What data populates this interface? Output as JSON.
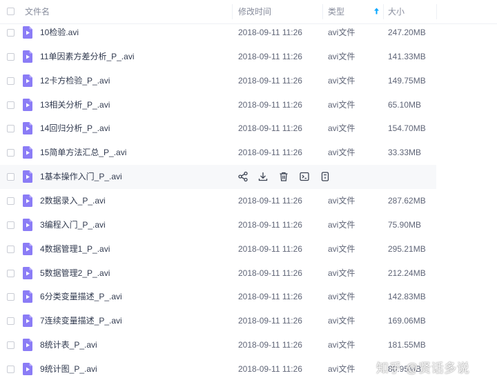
{
  "header": {
    "name_label": "文件名",
    "modified_label": "修改时间",
    "type_label": "类型",
    "size_label": "大小",
    "sort_icon": "sort-ascending-arrow-icon"
  },
  "colors": {
    "accent": "#06a7ff",
    "video_icon": "#8b7cf6",
    "hover_row": "#f7f8fa"
  },
  "files": [
    {
      "name": "10检验.avi",
      "modified": "2018-09-11 11:26",
      "type": "avi文件",
      "size": "247.20MB"
    },
    {
      "name": "11单因素方差分析_P_.avi",
      "modified": "2018-09-11 11:26",
      "type": "avi文件",
      "size": "141.33MB"
    },
    {
      "name": "12卡方检验_P_.avi",
      "modified": "2018-09-11 11:26",
      "type": "avi文件",
      "size": "149.75MB"
    },
    {
      "name": "13相关分析_P_.avi",
      "modified": "2018-09-11 11:26",
      "type": "avi文件",
      "size": "65.10MB"
    },
    {
      "name": "14回归分析_P_.avi",
      "modified": "2018-09-11 11:26",
      "type": "avi文件",
      "size": "154.70MB"
    },
    {
      "name": "15简单方法汇总_P_.avi",
      "modified": "2018-09-11 11:26",
      "type": "avi文件",
      "size": "33.33MB"
    },
    {
      "name": "1基本操作入门_P_.avi",
      "modified": "",
      "type": "",
      "size": ""
    },
    {
      "name": "2数据录入_P_.avi",
      "modified": "2018-09-11 11:26",
      "type": "avi文件",
      "size": "287.62MB"
    },
    {
      "name": "3编程入门_P_.avi",
      "modified": "2018-09-11 11:26",
      "type": "avi文件",
      "size": "75.90MB"
    },
    {
      "name": "4数据管理1_P_.avi",
      "modified": "2018-09-11 11:26",
      "type": "avi文件",
      "size": "295.21MB"
    },
    {
      "name": "5数据管理2_P_.avi",
      "modified": "2018-09-11 11:26",
      "type": "avi文件",
      "size": "212.24MB"
    },
    {
      "name": "6分类变量描述_P_.avi",
      "modified": "2018-09-11 11:26",
      "type": "avi文件",
      "size": "142.83MB"
    },
    {
      "name": "7连续变量描述_P_.avi",
      "modified": "2018-09-11 11:26",
      "type": "avi文件",
      "size": "169.06MB"
    },
    {
      "name": "8统计表_P_.avi",
      "modified": "2018-09-11 11:26",
      "type": "avi文件",
      "size": "181.55MB"
    },
    {
      "name": "9统计图_P_.avi",
      "modified": "2018-09-11 11:26",
      "type": "avi文件",
      "size": "80.95MB"
    }
  ],
  "hover_row_index": 6,
  "hover_actions": [
    {
      "name": "share-icon"
    },
    {
      "name": "download-icon"
    },
    {
      "name": "delete-icon"
    },
    {
      "name": "open-in-terminal-icon"
    },
    {
      "name": "more-info-icon"
    }
  ],
  "watermark": {
    "text": "知乎 @贤话多说"
  }
}
